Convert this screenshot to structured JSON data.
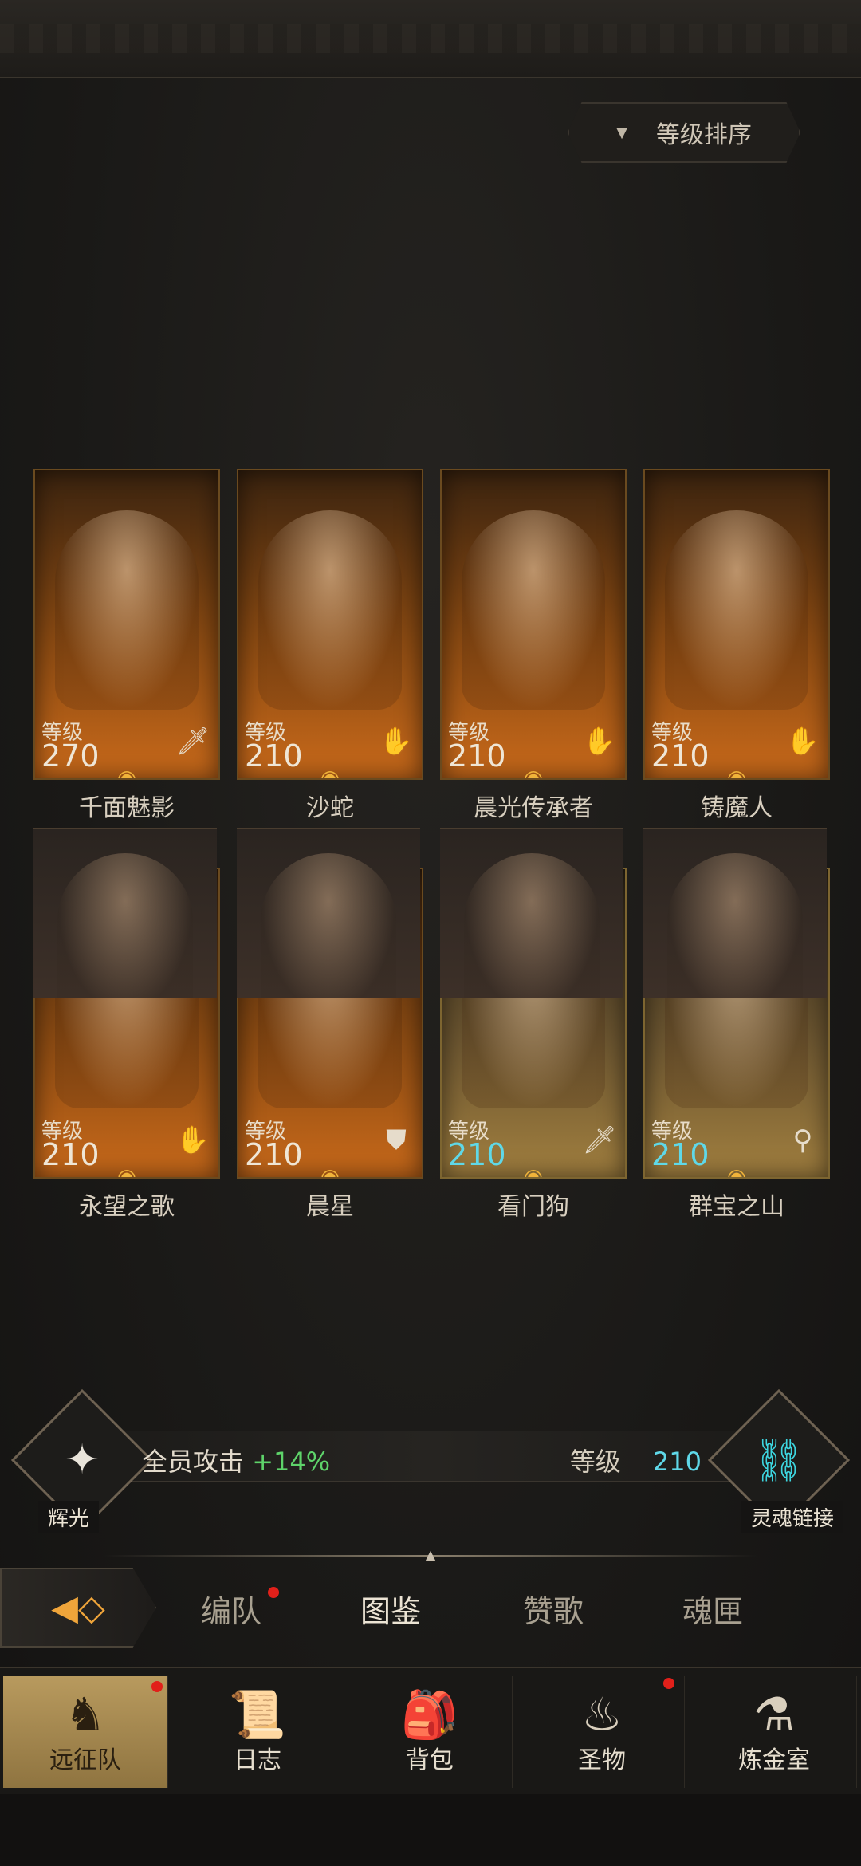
{
  "sort_button": {
    "label": "等级排序",
    "arrow": "▼"
  },
  "heroes": [
    {
      "name": "千面魅影",
      "level_label": "等级",
      "level": "270",
      "class_icon": "sword-icon",
      "glyph": "🗡",
      "tier": "orange"
    },
    {
      "name": "沙蛇",
      "level_label": "等级",
      "level": "210",
      "class_icon": "hand-icon",
      "glyph": "✋",
      "tier": "orange"
    },
    {
      "name": "晨光传承者",
      "level_label": "等级",
      "level": "210",
      "class_icon": "hand-icon",
      "glyph": "✋",
      "tier": "orange"
    },
    {
      "name": "铸魔人",
      "level_label": "等级",
      "level": "210",
      "class_icon": "hand-icon",
      "glyph": "✋",
      "tier": "orange"
    },
    {
      "name": "永望之歌",
      "level_label": "等级",
      "level": "210",
      "class_icon": "hand-icon",
      "glyph": "✋",
      "tier": "orange"
    },
    {
      "name": "晨星",
      "level_label": "等级",
      "level": "210",
      "class_icon": "shield-icon",
      "glyph": "⛊",
      "tier": "orange"
    },
    {
      "name": "看门狗",
      "level_label": "等级",
      "level": "210",
      "class_icon": "sword-icon",
      "glyph": "🗡",
      "tier": "gold"
    },
    {
      "name": "群宝之山",
      "level_label": "等级",
      "level": "210",
      "class_icon": "staff-icon",
      "glyph": "⚲",
      "tier": "gold"
    }
  ],
  "stats": {
    "left_label": "全员攻击",
    "left_value": "+14%",
    "left_emblem": "辉光",
    "right_label": "等级",
    "right_value": "210",
    "right_emblem": "灵魂链接"
  },
  "tabs": [
    {
      "label": "编队",
      "badge": true
    },
    {
      "label": "图鉴",
      "active": true
    },
    {
      "label": "赞歌"
    },
    {
      "label": "魂匣"
    }
  ],
  "nav": [
    {
      "label": "远征队",
      "icon": "viking-helmet-icon",
      "active": true,
      "badge": true
    },
    {
      "label": "日志",
      "icon": "scroll-icon"
    },
    {
      "label": "背包",
      "icon": "backpack-icon"
    },
    {
      "label": "圣物",
      "icon": "torch-icon",
      "badge": true
    },
    {
      "label": "炼金室",
      "icon": "alchemy-icon"
    }
  ]
}
